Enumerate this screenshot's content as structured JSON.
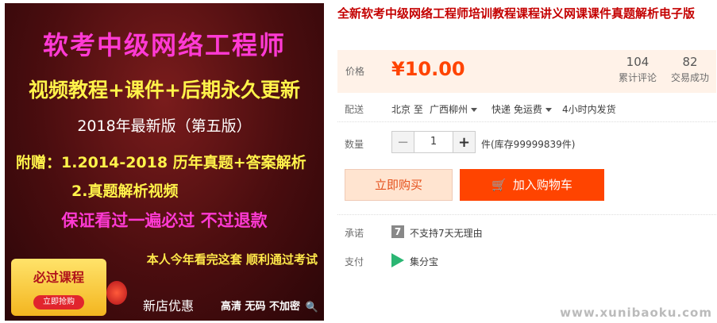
{
  "banner": {
    "title": "软考中级网络工程师",
    "subtitle": "视频教程+课件+后期永久更新",
    "version": "2018年最新版（第五版）",
    "gift_line1": "附赠：1.2014-2018 历年真题+答案解析",
    "gift_line2": "2.真题解析视频",
    "promise": "保证看过一遍必过 不过退款",
    "pass_line": "本人今年看完这套 顺利通过考试",
    "badge_title": "必过课程",
    "badge_button": "立即抢购",
    "new_store": "新店优惠",
    "hd_line": "高清 无码 不加密"
  },
  "product": {
    "title": "全新软考中级网络工程师培训教程课程讲义网课课件真题解析电子版"
  },
  "price": {
    "label": "价格",
    "value": "¥10.00",
    "reviews_count": "104",
    "reviews_label": "累计评论",
    "sales_count": "82",
    "sales_label": "交易成功"
  },
  "shipping": {
    "label": "配送",
    "from": "北京 至",
    "to": "广西柳州",
    "method": "快递 免运费",
    "time": "4小时内发货"
  },
  "quantity": {
    "label": "数量",
    "minus": "−",
    "value": "1",
    "plus": "+",
    "stock": "件(库存99999839件)"
  },
  "actions": {
    "buy_now": "立即购买",
    "add_cart": "加入购物车"
  },
  "promise": {
    "label": "承诺",
    "icon_text": "7",
    "text": "不支持7天无理由"
  },
  "payment": {
    "label": "支付",
    "text": "集分宝"
  },
  "watermark": "www.xunibaoku.com",
  "colors": {
    "accent": "#ff4400",
    "title": "#c40000",
    "price_bg": "#fff2e8"
  }
}
